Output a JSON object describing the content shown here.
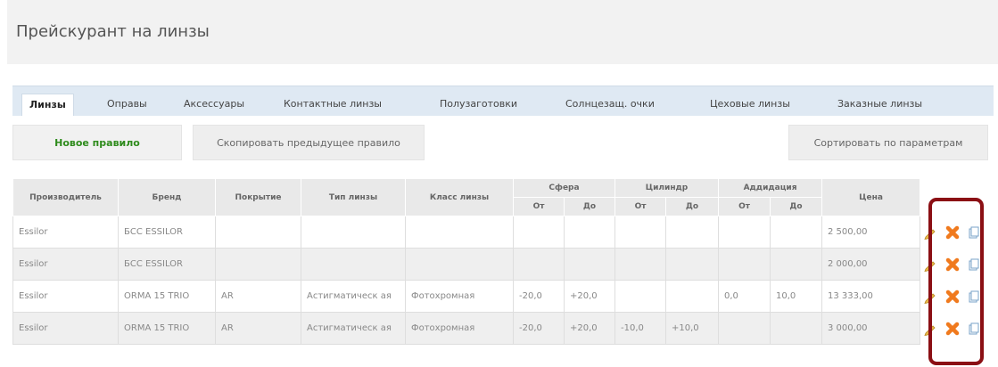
{
  "page": {
    "title": "Прейскурант на линзы"
  },
  "tabs": [
    {
      "label": "Линзы",
      "active": true
    },
    {
      "label": "Оправы"
    },
    {
      "label": "Аксессуары"
    },
    {
      "label": "Контактные линзы"
    },
    {
      "label": "Полузаготовки"
    },
    {
      "label": "Солнцезащ. очки"
    },
    {
      "label": "Цеховые линзы"
    },
    {
      "label": "Заказные линзы"
    }
  ],
  "toolbar": {
    "new_rule": "Новое правило",
    "copy_previous": "Скопировать предыдущее правило",
    "sort": "Сортировать по параметрам"
  },
  "table": {
    "headers": {
      "manufacturer": "Производитель",
      "brand": "Бренд",
      "coating": "Покрытие",
      "lens_type": "Тип линзы",
      "lens_class": "Класс линзы",
      "sphere": "Сфера",
      "cylinder": "Цилиндр",
      "addition": "Аддидация",
      "price": "Цена",
      "from": "От",
      "to": "До"
    },
    "rows": [
      {
        "manufacturer": "Essilor",
        "brand": "БСС ESSILOR",
        "coating": "",
        "lens_type": "",
        "lens_class": "",
        "sph_from": "",
        "sph_to": "",
        "cyl_from": "",
        "cyl_to": "",
        "add_from": "",
        "add_to": "",
        "price": "2 500,00"
      },
      {
        "manufacturer": "Essilor",
        "brand": "БСС ESSILOR",
        "coating": "",
        "lens_type": "",
        "lens_class": "",
        "sph_from": "",
        "sph_to": "",
        "cyl_from": "",
        "cyl_to": "",
        "add_from": "",
        "add_to": "",
        "price": "2 000,00"
      },
      {
        "manufacturer": "Essilor",
        "brand": "ORMA 15 TRIO",
        "coating": "AR",
        "lens_type": "Астигматическ ая",
        "lens_class": "Фотохромная",
        "sph_from": "-20,0",
        "sph_to": "+20,0",
        "cyl_from": "",
        "cyl_to": "",
        "add_from": "0,0",
        "add_to": "10,0",
        "price": "13 333,00"
      },
      {
        "manufacturer": "Essilor",
        "brand": "ORMA 15 TRIO",
        "coating": "AR",
        "lens_type": "Астигматическ ая",
        "lens_class": "Фотохромная",
        "sph_from": "-20,0",
        "sph_to": "+20,0",
        "cyl_from": "-10,0",
        "cyl_to": "+10,0",
        "add_from": "",
        "add_to": "",
        "price": "3 000,00"
      }
    ]
  },
  "icons": {
    "edit": "pencil-icon",
    "delete": "delete-x-icon",
    "copy": "copy-icon"
  },
  "colors": {
    "accent_green": "#2e8b1c",
    "delete_orange": "#f07a1e",
    "highlight": "#8b0f14",
    "tab_bar": "#dfe9f3"
  }
}
